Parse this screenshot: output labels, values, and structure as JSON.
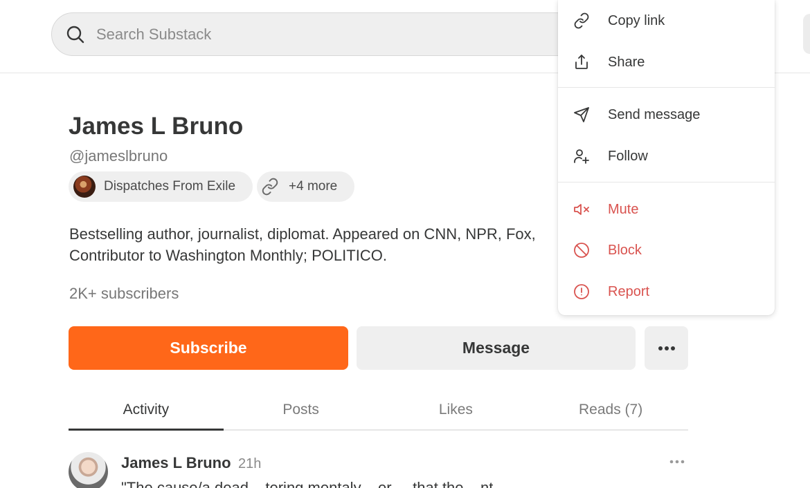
{
  "search": {
    "placeholder": "Search Substack"
  },
  "profile": {
    "name": "James L Bruno",
    "handle": "@jameslbruno",
    "publication": "Dispatches From Exile",
    "more_links": "+4 more",
    "bio": "Bestselling author, journalist, diplomat. Appeared on CNN, NPR, Fox, Contributor to Washington Monthly; POLITICO.",
    "subscribers": "2K+ subscribers"
  },
  "actions": {
    "subscribe": "Subscribe",
    "message": "Message"
  },
  "tabs": [
    {
      "label": "Activity",
      "active": true
    },
    {
      "label": "Posts",
      "active": false
    },
    {
      "label": "Likes",
      "active": false
    },
    {
      "label": "Reads (7)",
      "active": false
    }
  ],
  "feed": [
    {
      "author": "James L Bruno",
      "time": "21h",
      "text": "\"The cause/a dead ...tering mentaly ...er ... that the ...nt"
    }
  ],
  "menu": {
    "items": [
      {
        "label": "Copy link",
        "icon": "link-icon",
        "danger": false
      },
      {
        "label": "Share",
        "icon": "share-icon",
        "danger": false
      },
      {
        "label": "Send message",
        "icon": "send-icon",
        "danger": false
      },
      {
        "label": "Follow",
        "icon": "follow-user-icon",
        "danger": false
      },
      {
        "label": "Mute",
        "icon": "mute-icon",
        "danger": true
      },
      {
        "label": "Block",
        "icon": "block-icon",
        "danger": true
      },
      {
        "label": "Report",
        "icon": "report-icon",
        "danger": true
      }
    ]
  },
  "colors": {
    "accent": "#ff6719",
    "danger": "#d9534f",
    "text": "#363737",
    "muted": "#777777"
  }
}
